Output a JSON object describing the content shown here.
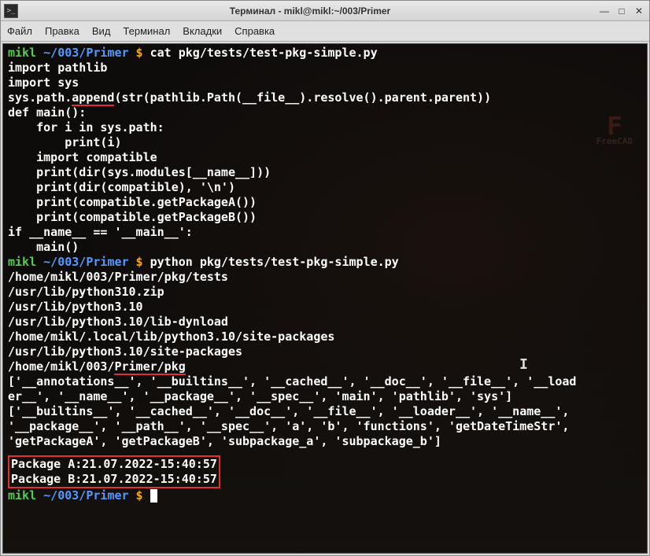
{
  "titlebar": {
    "icon_glyph": ">_",
    "title": "Терминал - mikl@mikl:~/003/Primer",
    "minimize": "—",
    "maximize": "□",
    "close": "✕"
  },
  "menubar": {
    "file": "Файл",
    "edit": "Правка",
    "view": "Вид",
    "terminal": "Терминал",
    "tabs": "Вкладки",
    "help": "Справка"
  },
  "badge": {
    "label": "FreeCAD",
    "glyph": "F"
  },
  "ibeam": {
    "glyph": "I"
  },
  "term": {
    "p1_user": "mikl ",
    "p1_path": "~/003/Primer",
    "p1_dollar": " $ ",
    "cmd1": "cat pkg/tests/test-pkg-simple.py",
    "src1": "import pathlib",
    "src2": "import sys",
    "src3": "",
    "src4a": "sys.path.",
    "src4_u": "append",
    "src4b": "(str(pathlib.Path(__file__).resolve().parent.parent))",
    "src5": "",
    "src6": "def main():",
    "src7": "    for i in sys.path:",
    "src8": "        print(i)",
    "src9": "    import compatible",
    "src10": "    print(dir(sys.modules[__name__]))",
    "src11": "    print(dir(compatible), '\\n')",
    "src12": "    print(compatible.getPackageA())",
    "src13": "    print(compatible.getPackageB())",
    "src14": "",
    "src15": "if __name__ == '__main__':",
    "src16": "    main()",
    "p2_user": "mikl ",
    "p2_path": "~/003/Primer",
    "p2_dollar": " $ ",
    "cmd2": "python pkg/tests/test-pkg-simple.py",
    "out1": "/home/mikl/003/Primer/pkg/tests",
    "out2": "/usr/lib/python310.zip",
    "out3": "/usr/lib/python3.10",
    "out4": "/usr/lib/python3.10/lib-dynload",
    "out5": "/home/mikl/.local/lib/python3.10/site-packages",
    "out6": "/usr/lib/python3.10/site-packages",
    "out7a": "/home/mikl/003/",
    "out7_u": "Primer/pkg",
    "out8": "['__annotations__', '__builtins__', '__cached__', '__doc__', '__file__', '__load",
    "out9": "er__', '__name__', '__package__', '__spec__', 'main', 'pathlib', 'sys']",
    "out10": "['__builtins__', '__cached__', '__doc__', '__file__', '__loader__', '__name__',",
    "out11": "'__package__', '__path__', '__spec__', 'a', 'b', 'functions', 'getDateTimeStr',",
    "out12": "'getPackageA', 'getPackageB', 'subpackage_a', 'subpackage_b'] ",
    "out13": "",
    "box1": "Package A:21.07.2022-15:40:57",
    "box2": "Package B:21.07.2022-15:40:57",
    "p3_user": "mikl ",
    "p3_path": "~/003/Primer",
    "p3_dollar": " $ "
  }
}
